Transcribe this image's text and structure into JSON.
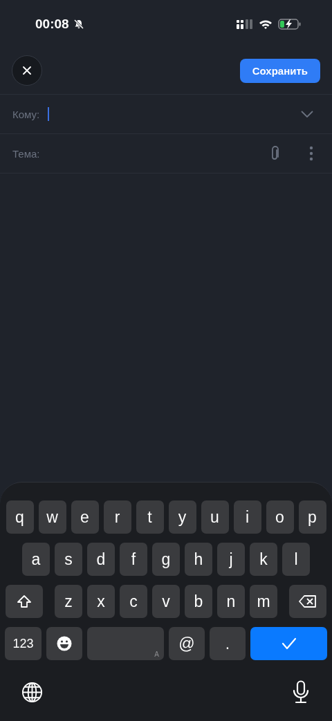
{
  "status_bar": {
    "time": "00:08",
    "muted": true
  },
  "header": {
    "save_button": "Сохранить"
  },
  "fields": [
    {
      "kind": "recipient",
      "label": "Кому:",
      "focused": true
    },
    {
      "kind": "subject",
      "label": "Тема:"
    }
  ],
  "keyboard": {
    "rows": [
      [
        {
          "kind": "letter",
          "label": "q"
        },
        {
          "kind": "letter",
          "label": "w"
        },
        {
          "kind": "letter",
          "label": "e"
        },
        {
          "kind": "letter",
          "label": "r"
        },
        {
          "kind": "letter",
          "label": "t"
        },
        {
          "kind": "letter",
          "label": "y"
        },
        {
          "kind": "letter",
          "label": "u"
        },
        {
          "kind": "letter",
          "label": "i"
        },
        {
          "kind": "letter",
          "label": "o"
        },
        {
          "kind": "letter",
          "label": "p"
        }
      ],
      [
        {
          "kind": "letter",
          "label": "a"
        },
        {
          "kind": "letter",
          "label": "s"
        },
        {
          "kind": "letter",
          "label": "d"
        },
        {
          "kind": "letter",
          "label": "f"
        },
        {
          "kind": "letter",
          "label": "g"
        },
        {
          "kind": "letter",
          "label": "h"
        },
        {
          "kind": "letter",
          "label": "j"
        },
        {
          "kind": "letter",
          "label": "k"
        },
        {
          "kind": "letter",
          "label": "l"
        }
      ],
      [
        {
          "kind": "shift"
        },
        {
          "kind": "letter",
          "label": "z"
        },
        {
          "kind": "letter",
          "label": "x"
        },
        {
          "kind": "letter",
          "label": "c"
        },
        {
          "kind": "letter",
          "label": "v"
        },
        {
          "kind": "letter",
          "label": "b"
        },
        {
          "kind": "letter",
          "label": "n"
        },
        {
          "kind": "letter",
          "label": "m"
        },
        {
          "kind": "backspace"
        }
      ],
      [
        {
          "kind": "numbers",
          "label": "123"
        },
        {
          "kind": "emoji"
        },
        {
          "kind": "space",
          "label": "A"
        },
        {
          "kind": "symbol",
          "label": "@"
        },
        {
          "kind": "symbol",
          "label": "."
        },
        {
          "kind": "done"
        }
      ]
    ]
  }
}
